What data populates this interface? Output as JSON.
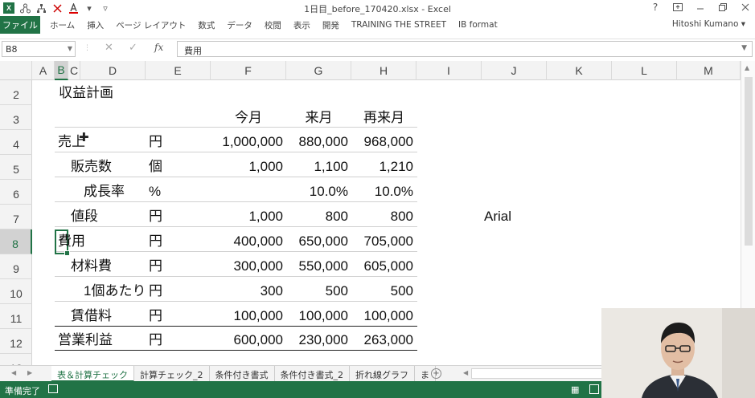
{
  "window": {
    "title": "1日目_before_170420.xlsx - Excel",
    "user": "Hitoshi Kumano",
    "help_label": "?"
  },
  "ribbon": {
    "file_tab": "ファイル",
    "tabs": [
      "ホーム",
      "挿入",
      "ページ レイアウト",
      "数式",
      "データ",
      "校閲",
      "表示",
      "開発",
      "TRAINING THE STREET",
      "IB format"
    ]
  },
  "formula_bar": {
    "name_box": "B8",
    "fx_label": "fx",
    "formula": "費用"
  },
  "columns": [
    "A",
    "B",
    "C",
    "D",
    "E",
    "F",
    "G",
    "H",
    "I",
    "J",
    "K",
    "L",
    "M"
  ],
  "rows": [
    "2",
    "3",
    "4",
    "5",
    "6",
    "7",
    "8",
    "9",
    "10",
    "11",
    "12",
    "13"
  ],
  "active_cell": {
    "column": "B",
    "row": "8"
  },
  "sheet": {
    "title": "収益計画",
    "headers": {
      "current": "今月",
      "next": "来月",
      "after_next": "再来月"
    },
    "lines": [
      {
        "label": "売上",
        "unit": "円",
        "v1": "1,000,000",
        "v2": "880,000",
        "v3": "968,000"
      },
      {
        "label": "販売数",
        "unit": "個",
        "v1": "1,000",
        "v2": "1,100",
        "v3": "1,210"
      },
      {
        "label": "成長率",
        "unit": "%",
        "v1": "",
        "v2": "10.0%",
        "v3": "10.0%"
      },
      {
        "label": "値段",
        "unit": "円",
        "v1": "1,000",
        "v2": "800",
        "v3": "800"
      },
      {
        "label": "費用",
        "unit": "円",
        "v1": "400,000",
        "v2": "650,000",
        "v3": "705,000"
      },
      {
        "label": "材料費",
        "unit": "円",
        "v1": "300,000",
        "v2": "550,000",
        "v3": "605,000"
      },
      {
        "label": "1個あたり",
        "unit": "円",
        "v1": "300",
        "v2": "500",
        "v3": "500"
      },
      {
        "label": "賃借料",
        "unit": "円",
        "v1": "100,000",
        "v2": "100,000",
        "v3": "100,000"
      },
      {
        "label": "営業利益",
        "unit": "円",
        "v1": "600,000",
        "v2": "230,000",
        "v3": "263,000"
      }
    ],
    "note": "Arial"
  },
  "sheet_tabs": [
    "表＆計算チェック",
    "計算チェック_2",
    "条件付き書式",
    "条件付き書式_2",
    "折れ線グラフ",
    "ま"
  ],
  "active_sheet_index": 0,
  "status": {
    "text": "準備完了"
  },
  "colors": {
    "accent": "#217346"
  }
}
